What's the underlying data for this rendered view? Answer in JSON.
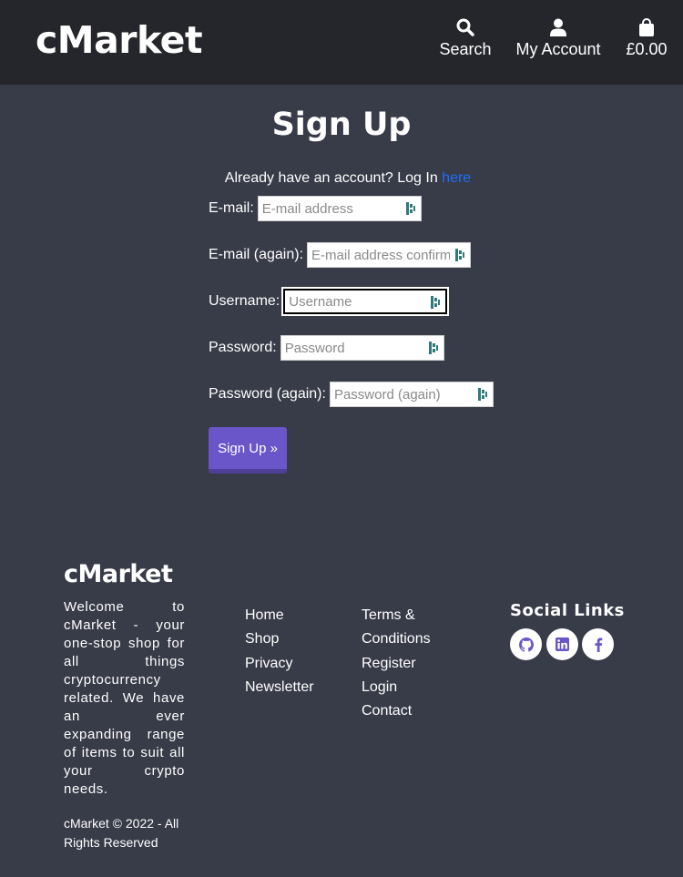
{
  "header": {
    "logo": "cMarket",
    "nav": {
      "search": "Search",
      "account": "My Account",
      "bag_total": "£0.00"
    }
  },
  "main": {
    "title": "Sign Up",
    "login_prompt": "Already have an account? Log In ",
    "login_link": "here",
    "fields": {
      "email": {
        "label": "E-mail:",
        "placeholder": "E-mail address"
      },
      "email2": {
        "label": "E-mail (again):",
        "placeholder": "E-mail address confirmation"
      },
      "username": {
        "label": "Username:",
        "placeholder": "Username"
      },
      "password": {
        "label": "Password:",
        "placeholder": "Password"
      },
      "password2": {
        "label": "Password (again):",
        "placeholder": "Password (again)"
      }
    },
    "submit": "Sign Up »"
  },
  "footer": {
    "logo": "cMarket",
    "about": "Welcome to cMarket - your one-stop shop for all things cryptocurrency related. We have an ever expanding range of items to suit all your crypto needs.",
    "links_col1": [
      "Home",
      "Shop",
      "Privacy",
      "Newsletter"
    ],
    "links_col2": [
      "Terms &",
      "Conditions",
      "Register",
      "Login",
      "Contact"
    ],
    "social_title": "Social Links",
    "social": [
      "github-icon",
      "linkedin-icon",
      "facebook-icon"
    ],
    "copyright": "cMarket © 2022 - All Rights Reserved"
  },
  "colors": {
    "background": "#383b48",
    "header": "#25262b",
    "accent": "#6a55c9",
    "link": "#1e6fff"
  }
}
